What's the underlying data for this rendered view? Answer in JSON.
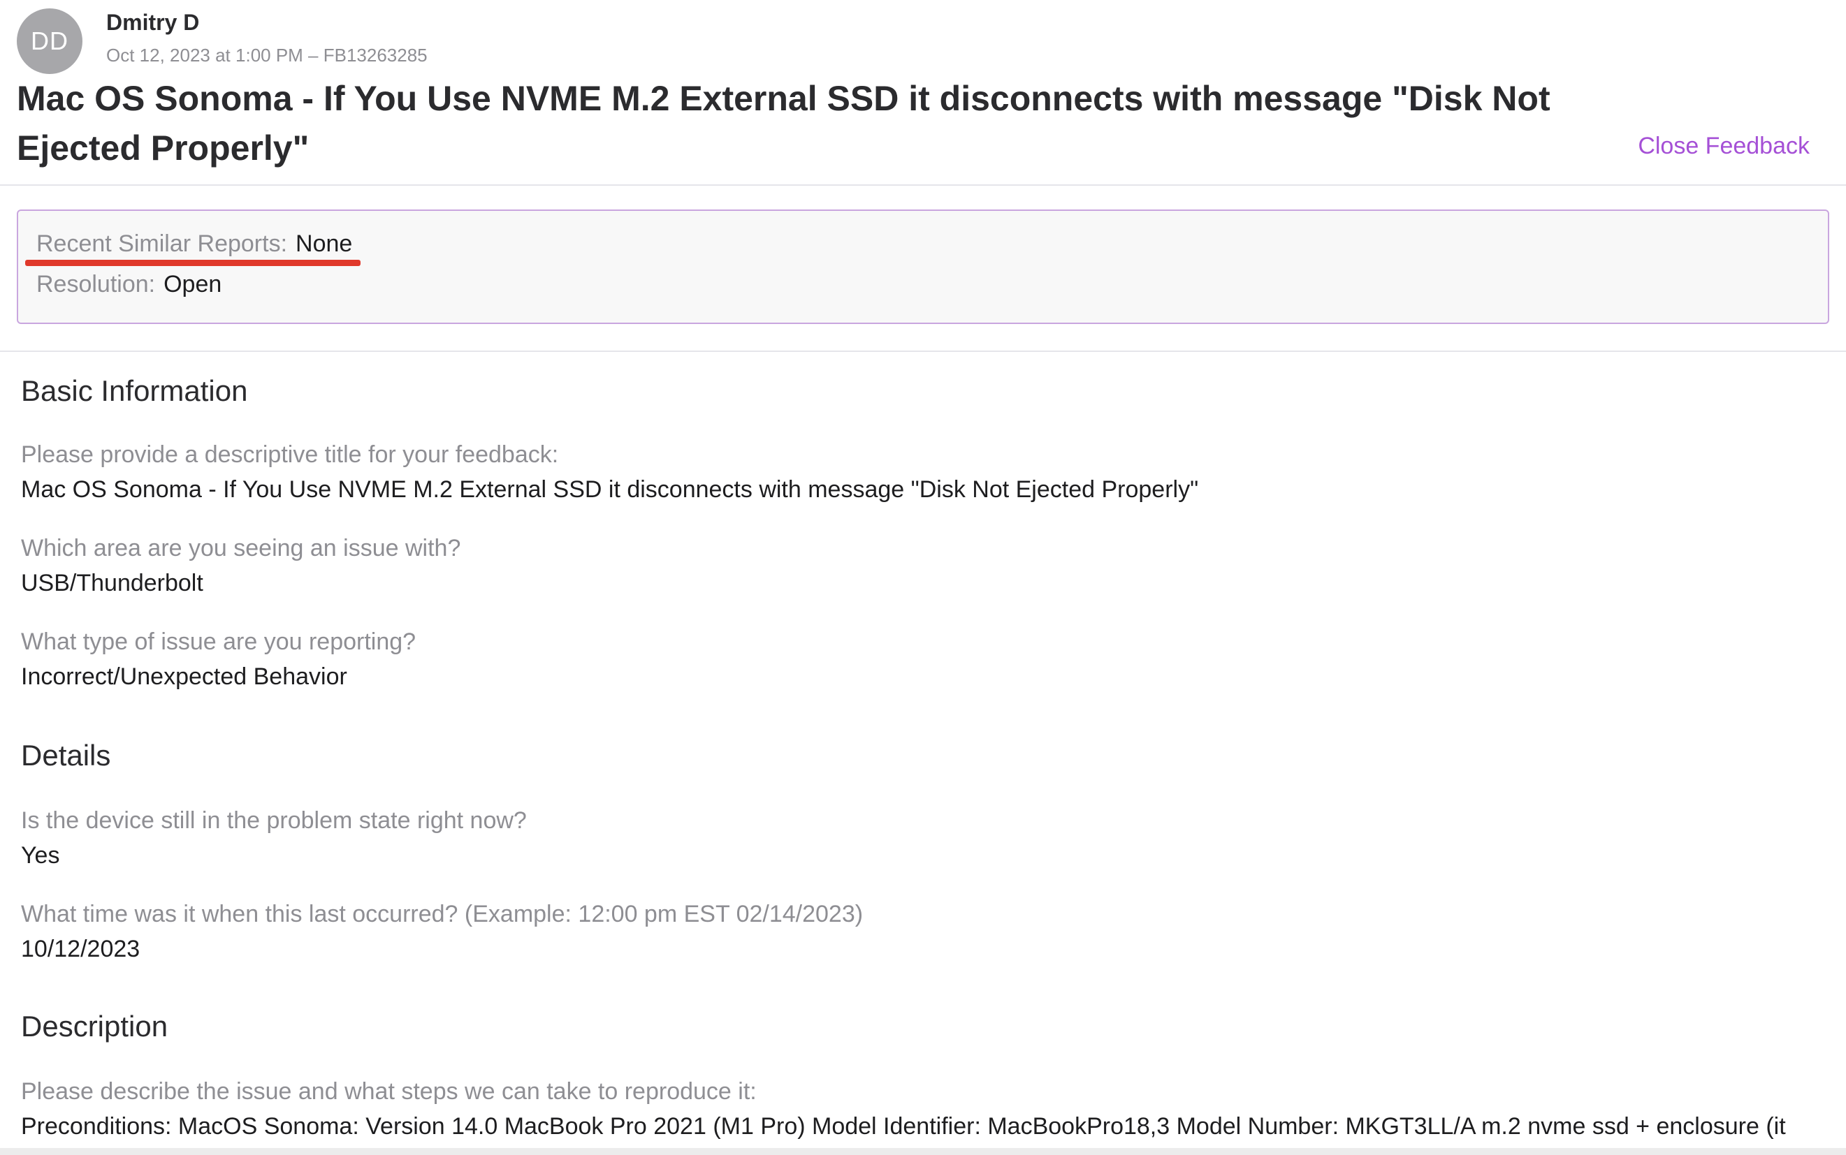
{
  "header": {
    "avatar_initials": "DD",
    "author": "Dmitry D",
    "meta": "Oct 12, 2023 at 1:00 PM – FB13263285",
    "title": "Mac OS Sonoma - If You Use NVME M.2 External SSD it disconnects with message \"Disk Not Ejected Properly\"",
    "close_label": "Close Feedback"
  },
  "status": {
    "similar_label": "Recent Similar Reports:",
    "similar_value": "None",
    "resolution_label": "Resolution:",
    "resolution_value": "Open"
  },
  "sections": {
    "basic": "Basic Information",
    "details": "Details",
    "description": "Description"
  },
  "basic": [
    {
      "question": "Please provide a descriptive title for your feedback:",
      "answer": "Mac OS Sonoma - If You Use NVME M.2 External SSD it disconnects with message \"Disk Not Ejected Properly\""
    },
    {
      "question": "Which area are you seeing an issue with?",
      "answer": "USB/Thunderbolt"
    },
    {
      "question": "What type of issue are you reporting?",
      "answer": "Incorrect/Unexpected Behavior"
    }
  ],
  "details": [
    {
      "question": "Is the device still in the problem state right now?",
      "answer": "Yes"
    },
    {
      "question": "What time was it when this last occurred? (Example: 12:00 pm EST 02/14/2023)",
      "answer": "10/12/2023"
    }
  ],
  "description": {
    "question": "Please describe the issue and what steps we can take to reproduce it:",
    "answer": "Preconditions: MacOS Sonoma: Version 14.0 MacBook Pro 2021 (M1 Pro) Model Identifier: MacBookPro18,3 Model Number: MKGT3LL/A m.2 nvme ssd + enclosure (it"
  },
  "colors": {
    "accent": "#a550d6",
    "annotation": "#e0392b",
    "muted": "#8e8e93"
  }
}
